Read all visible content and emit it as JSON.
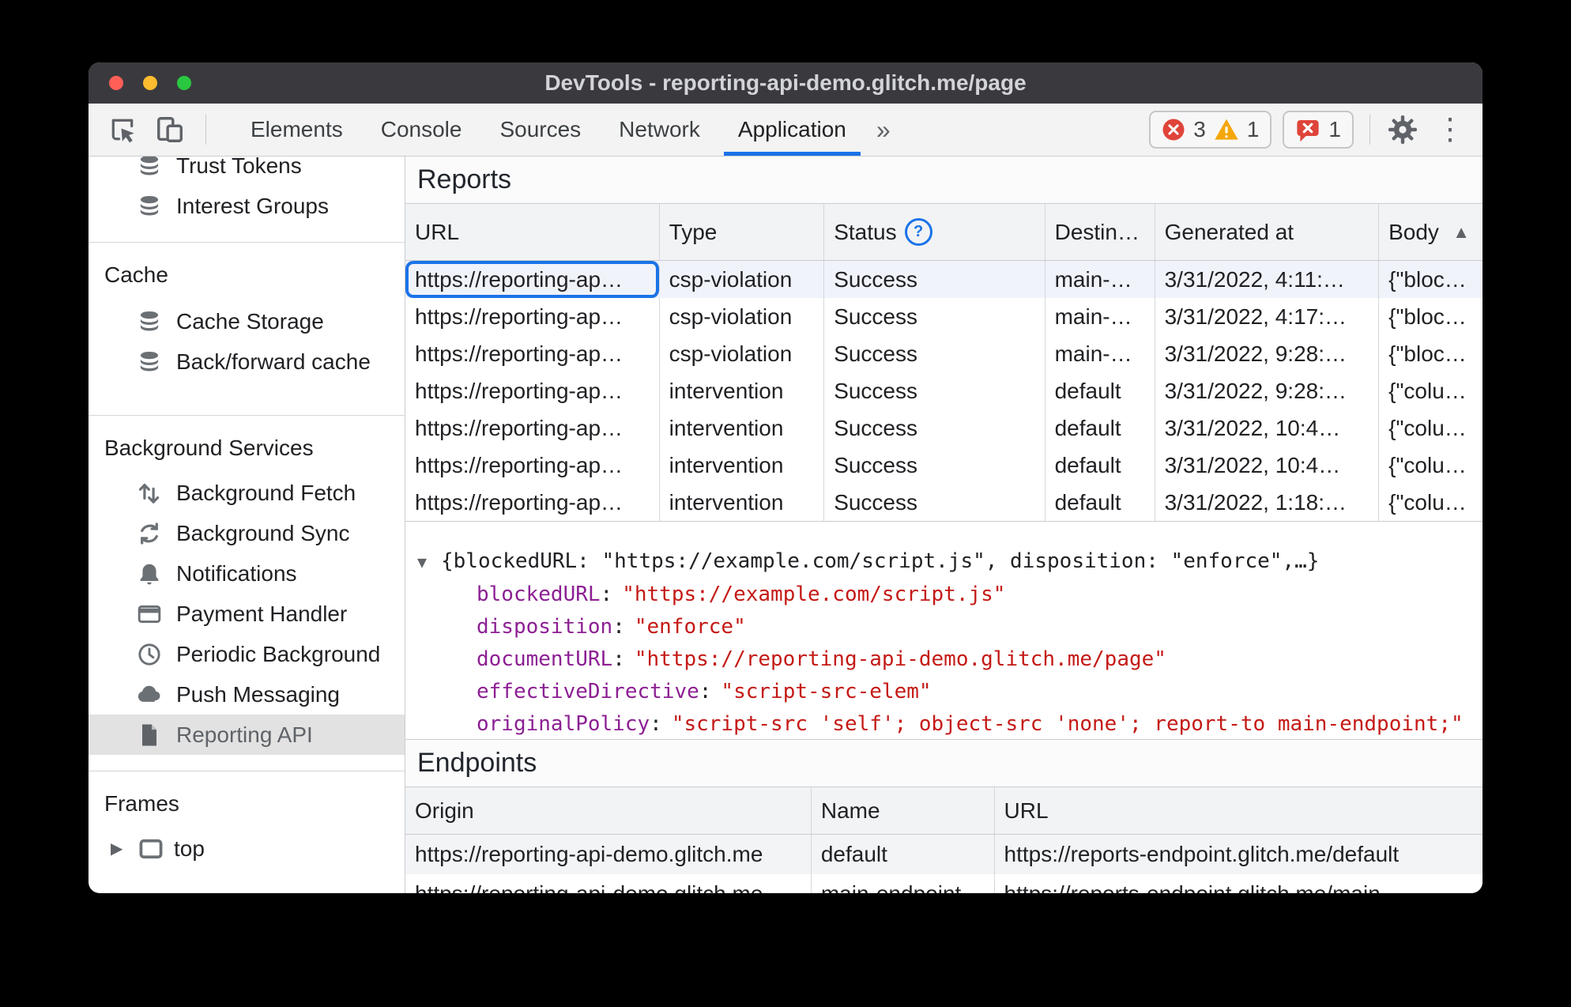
{
  "window": {
    "title": "DevTools - reporting-api-demo.glitch.me/page"
  },
  "toolbar": {
    "tabs": [
      {
        "label": "Elements",
        "active": false
      },
      {
        "label": "Console",
        "active": false
      },
      {
        "label": "Sources",
        "active": false
      },
      {
        "label": "Network",
        "active": false
      },
      {
        "label": "Application",
        "active": true
      }
    ],
    "more_tabs_glyph": "»",
    "error_count": "3",
    "warning_count": "1",
    "issue_count": "1"
  },
  "sidebar": {
    "top_items": [
      {
        "label": "Trust Tokens",
        "icon": "database-icon"
      },
      {
        "label": "Interest Groups",
        "icon": "database-icon"
      }
    ],
    "sections": [
      {
        "title": "Cache",
        "items": [
          {
            "label": "Cache Storage",
            "icon": "database-icon"
          },
          {
            "label": "Back/forward cache",
            "icon": "database-icon"
          }
        ]
      },
      {
        "title": "Background Services",
        "items": [
          {
            "label": "Background Fetch",
            "icon": "fetch-icon"
          },
          {
            "label": "Background Sync",
            "icon": "sync-icon"
          },
          {
            "label": "Notifications",
            "icon": "bell-icon"
          },
          {
            "label": "Payment Handler",
            "icon": "card-icon"
          },
          {
            "label": "Periodic Background",
            "icon": "clock-icon"
          },
          {
            "label": "Push Messaging",
            "icon": "cloud-icon"
          },
          {
            "label": "Reporting API",
            "icon": "document-icon",
            "selected": true
          }
        ]
      },
      {
        "title": "Frames",
        "items": [
          {
            "label": "top",
            "icon": "frame-icon",
            "expander": "▶"
          }
        ]
      }
    ]
  },
  "reports": {
    "title": "Reports",
    "columns": {
      "url": "URL",
      "type": "Type",
      "status": "Status",
      "destination": "Destin…",
      "generated": "Generated at",
      "body": "Body"
    },
    "rows": [
      {
        "url": "https://reporting-ap…",
        "type": "csp-violation",
        "status": "Success",
        "destination": "main-…",
        "generated": "3/31/2022, 4:11:…",
        "body": "{\"bloc…"
      },
      {
        "url": "https://reporting-ap…",
        "type": "csp-violation",
        "status": "Success",
        "destination": "main-…",
        "generated": "3/31/2022, 4:17:…",
        "body": "{\"bloc…"
      },
      {
        "url": "https://reporting-ap…",
        "type": "csp-violation",
        "status": "Success",
        "destination": "main-…",
        "generated": "3/31/2022, 9:28:…",
        "body": "{\"bloc…"
      },
      {
        "url": "https://reporting-ap…",
        "type": "intervention",
        "status": "Success",
        "destination": "default",
        "generated": "3/31/2022, 9:28:…",
        "body": "{\"colu…"
      },
      {
        "url": "https://reporting-ap…",
        "type": "intervention",
        "status": "Success",
        "destination": "default",
        "generated": "3/31/2022, 10:4…",
        "body": "{\"colu…"
      },
      {
        "url": "https://reporting-ap…",
        "type": "intervention",
        "status": "Success",
        "destination": "default",
        "generated": "3/31/2022, 10:4…",
        "body": "{\"colu…"
      },
      {
        "url": "https://reporting-ap…",
        "type": "intervention",
        "status": "Success",
        "destination": "default",
        "generated": "3/31/2022, 1:18:…",
        "body": "{\"colu…"
      }
    ],
    "detail": {
      "preview": "{blockedURL: \"https://example.com/script.js\", disposition: \"enforce\",…}",
      "colon": ":",
      "fields": [
        {
          "key": "blockedURL",
          "value": "\"https://example.com/script.js\""
        },
        {
          "key": "disposition",
          "value": "\"enforce\""
        },
        {
          "key": "documentURL",
          "value": "\"https://reporting-api-demo.glitch.me/page\""
        },
        {
          "key": "effectiveDirective",
          "value": "\"script-src-elem\""
        },
        {
          "key": "originalPolicy",
          "value": "\"script-src 'self'; object-src 'none'; report-to main-endpoint;\""
        }
      ]
    }
  },
  "endpoints": {
    "title": "Endpoints",
    "columns": {
      "origin": "Origin",
      "name": "Name",
      "url": "URL"
    },
    "rows": [
      {
        "origin": "https://reporting-api-demo.glitch.me",
        "name": "default",
        "url": "https://reports-endpoint.glitch.me/default"
      },
      {
        "origin": "https://reporting-api-demo.glitch.me",
        "name": "main-endpoint",
        "url": "https://reports-endpoint.glitch.me/main"
      }
    ]
  },
  "glyphs": {
    "sort_asc": "▲",
    "detail_open": "▼",
    "expander_closed": "▶",
    "help": "?",
    "kebab": "⋮"
  },
  "colors": {
    "accent_blue": "#1a73e8",
    "error_red": "#e0443a",
    "warning_orange": "#f5a70a",
    "json_key_purple": "#8c1f93",
    "json_value_red": "#c41a16",
    "titlebar_bg": "#3a3a3e"
  }
}
